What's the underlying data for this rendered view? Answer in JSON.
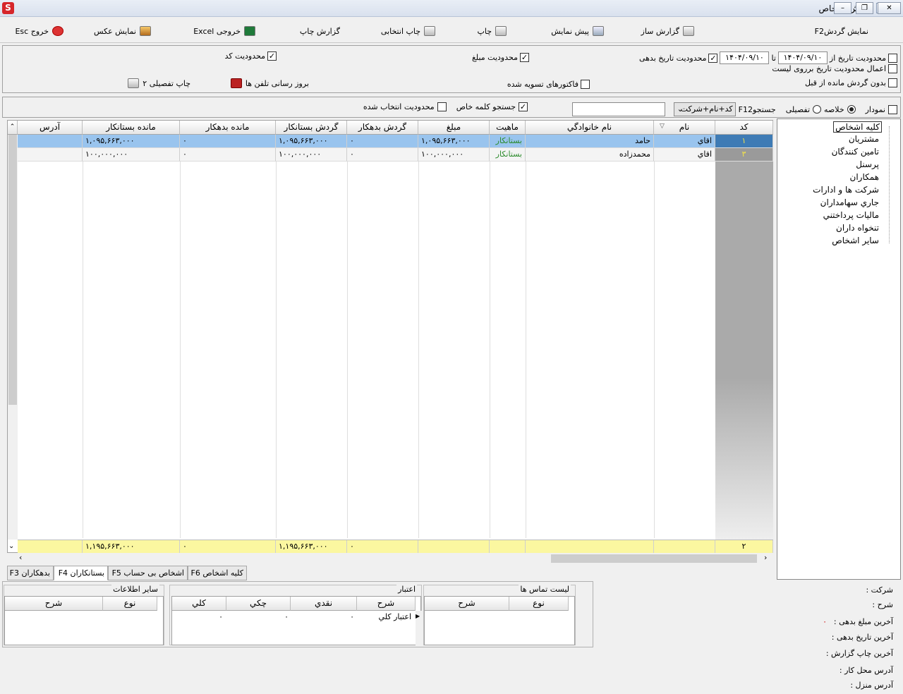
{
  "window": {
    "title": "گردش اشخاص",
    "sys_icon": "S"
  },
  "toolbar": {
    "show_turnover": "نمایش گردشF2",
    "report_builder": "گزارش ساز",
    "preview": "پیش نمایش",
    "print": "چاپ",
    "print_selected": "چاپ انتخابی",
    "print_report": "گزارش چاپ",
    "excel": "خروجی Excel",
    "show_photo": "نمایش عکس",
    "exit": "خروج Esc"
  },
  "filters": {
    "date_limit_label": "محدودیت تاریخ از",
    "date_from": "۱۴۰۴/۰۹/۱۰",
    "to_label": "تا",
    "date_to": "۱۴۰۴/۰۹/۱۰",
    "debt_date_limit": "محدودیت تاریخ بدهی",
    "amount_limit": "محدودیت مبلغ",
    "code_limit": "محدودیت کد",
    "apply_date_on_list": "اعمال محدودیت تاریخ برروی لیست",
    "no_prior_balance": "بدون گردش مانده از قبل",
    "settled_invoices": "فاکتورهای تسویه شده",
    "sms_update": "بروز رسانی تلفن ها",
    "print_detail2": "چاپ تفصیلی ۲"
  },
  "search": {
    "chart": "نمودار",
    "summary": "خلاصه",
    "detailed": "تفصیلی",
    "search_label": "جستجوF12",
    "mode": "کد+نام+شرکت",
    "special_keyword": "جستجو کلمه خاص",
    "selected_limit": "محدودیت انتخاب شده",
    "query": ""
  },
  "grid": {
    "headers": [
      "کد",
      "نام",
      "نام خانوادگي",
      "ماهيت",
      "مبلغ",
      "گردش بدهکار",
      "گردش بستانکار",
      "مانده بدهکار",
      "مانده بستانکار",
      "آدرس"
    ],
    "rows": [
      {
        "code": "۱",
        "name": "اقاي",
        "family": "حامد",
        "nature": "بستانکار",
        "amount": "۱,۰۹۵,۶۶۳,۰۰۰",
        "debit_turn": "۰",
        "credit_turn": "۱,۰۹۵,۶۶۳,۰۰۰",
        "debit_bal": "۰",
        "credit_bal": "۱,۰۹۵,۶۶۳,۰۰۰",
        "address": ""
      },
      {
        "code": "۳",
        "name": "اقاي",
        "family": "محمدزاده",
        "nature": "بستانکار",
        "amount": "۱۰۰,۰۰۰,۰۰۰",
        "debit_turn": "۰",
        "credit_turn": "۱۰۰,۰۰۰,۰۰۰",
        "debit_bal": "۰",
        "credit_bal": "۱۰۰,۰۰۰,۰۰۰",
        "address": ""
      }
    ],
    "footer": {
      "count": "۲",
      "debit_turn": "۰",
      "credit_turn": "۱,۱۹۵,۶۶۳,۰۰۰",
      "debit_bal": "۰",
      "credit_bal": "۱,۱۹۵,۶۶۳,۰۰۰"
    }
  },
  "tree": {
    "items": [
      "کلیه اشخاص",
      "مشتریان",
      "تامین کنندگان",
      "پرسنل",
      "همکاران",
      "شرکت ها و ادارات",
      "جاري سهامداران",
      "ماليات پرداختني",
      "تنخواه داران",
      "سایر اشخاص"
    ]
  },
  "tabs": [
    "کلیه اشخاص F6",
    "اشخاص بی حساب F5",
    "بستانکاران F4",
    "بدهکاران F3"
  ],
  "bottom": {
    "contacts_title": "لیست تماس ها",
    "contacts_headers": [
      "نوع",
      "شرح"
    ],
    "credit_title": "اعتبار",
    "credit_headers": [
      "شرح",
      "نقدي",
      "چكي",
      "كلي"
    ],
    "credit_row": {
      "desc": "اعتبار كلي",
      "cash": "۰",
      "cheque": "۰",
      "total": "۰"
    },
    "other_title": "سایر اطلاعات",
    "other_headers": [
      "نوع",
      "شرح"
    ],
    "info": {
      "company": "شرکت :",
      "desc": "شرح :",
      "last_debt_amount": "آخرین مبلغ بدهی :",
      "last_debt_amount_value": "۰",
      "last_debt_date": "آخرین تاریخ بدهی :",
      "last_print": "آخرین چاپ گزارش :",
      "work_address": "آدرس محل کار :",
      "home_address": "آدرس منزل :"
    }
  }
}
